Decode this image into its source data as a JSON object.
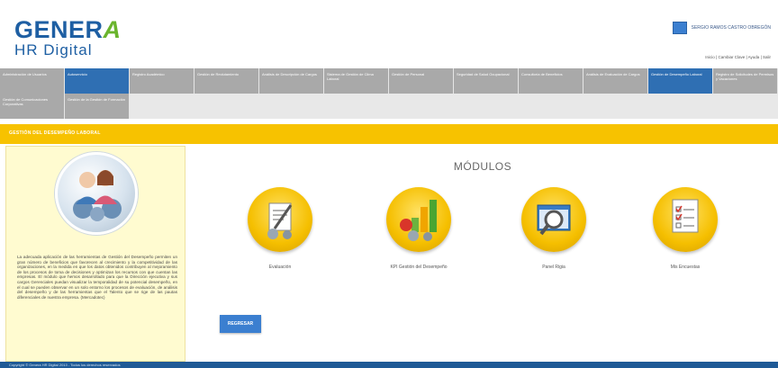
{
  "brand": {
    "logo_top": "GENER",
    "logo_accent": "A",
    "logo_bottom": "HR Digital"
  },
  "user": {
    "name": "SERGIO RAMOS CASTRO OBREGÓN",
    "links": "Inicio | Cambiar Clave | Ayuda | Salir"
  },
  "nav": {
    "row1": [
      "Administración de Usuarios",
      "Autoservicio",
      "Registro Académico",
      "Gestión de Reclutamiento",
      "Análisis de Descripción de Cargos",
      "Sistema de Gestión de Clima Laboral",
      "Gestión de Personal",
      "Seguridad de Salud Ocupacional",
      "Consultoría de Beneficios",
      "Análisis de Evaluación de Cargos",
      "Gestión de Desempeño Laboral",
      "Registro de Solicitudes de Permisos y Vacaciones"
    ],
    "row2": [
      "Gestión de Comunicaciones Corporativas",
      "Gestión de la Gestión de Formación"
    ]
  },
  "page": {
    "section_title": "GESTIÓN DEL DESEMPEÑO LABORAL"
  },
  "left_panel": {
    "description": "La adecuada aplicación de las herramientas de Gestión del Desempeño permiten un gran número de beneficios que favorecen al crecimiento y la competitividad de las organizaciones, en la medida en que los datos obtenidos contribuyen al mejoramiento de los procesos de toma de decisiones y optimizan los recursos con que cuentan las empresas. El módulo que hemos desarrollado para que la Dirección ejecutiva y sus cargos Gerenciales puedan visualizar la temporalidad de su potencial desempeño, en el cual se pueden observar en un solo entorno los procesos de evaluación, de análisis del desempeño y de las herramientas que el Talento que se rige de las pautas diferenciales de nuestra empresa. (Mercadotec)"
  },
  "main": {
    "modules_title": "MÓDULOS",
    "modules": [
      {
        "label": "Evaluación",
        "icon": "clipboard-pen-icon"
      },
      {
        "label": "KPI Gestión del Desempeño",
        "icon": "bar-chart-icon"
      },
      {
        "label": "Panel Rigia",
        "icon": "magnifier-window-icon"
      },
      {
        "label": "Mis Encuestas",
        "icon": "checklist-icon"
      }
    ],
    "back_label": "REGRESAR"
  },
  "footer": {
    "text": "Copyright © Genera HR Digital 2013 - Todos los derechos reservados"
  },
  "colors": {
    "primary": "#2f6fb3",
    "accent": "#f7c200",
    "nav_gray": "#a9a9a9"
  }
}
